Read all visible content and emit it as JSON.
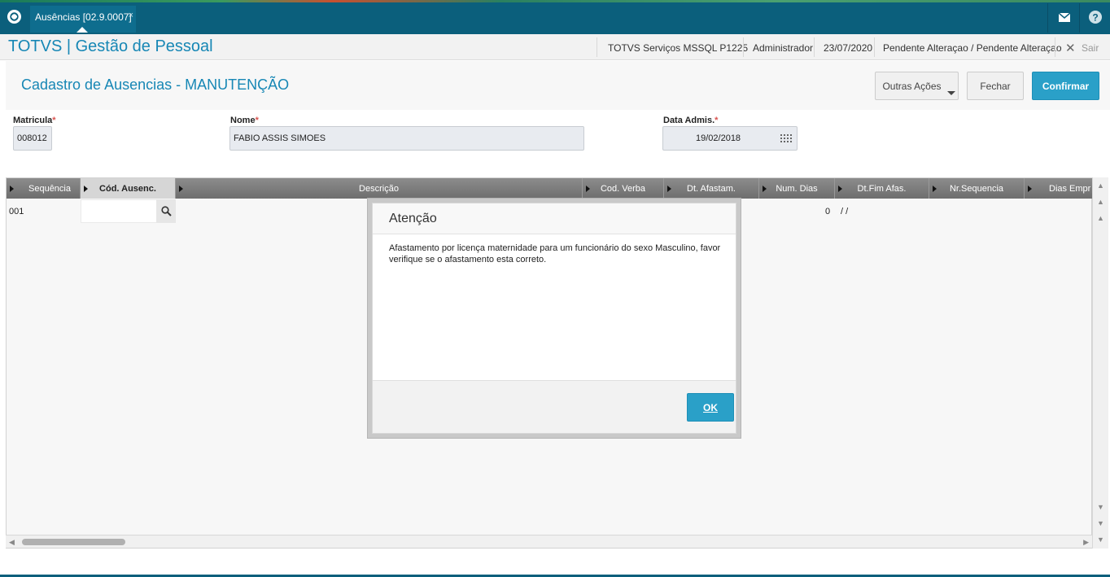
{
  "topbar": {
    "tab_label": "Ausências [02.9.0007]",
    "tab_close": "×",
    "icons": [
      "totvs-logo-icon",
      "mail-icon",
      "help-icon"
    ]
  },
  "header": {
    "app_title": "TOTVS | Gestão de Pessoal",
    "environment": "TOTVS Serviços MSSQL P1225",
    "user": "Administrador",
    "date": "23/07/2020",
    "status": "Pendente Alteraçao / Pendente Alteraçao",
    "exit_label": "Sair"
  },
  "page": {
    "title": "Cadastro de Ausencias - MANUTENÇÃO",
    "actions": {
      "other_actions": "Outras Ações",
      "close": "Fechar",
      "confirm": "Confirmar"
    }
  },
  "form": {
    "matricula": {
      "label": "Matricula",
      "required": "*",
      "value": "008012"
    },
    "nome": {
      "label": "Nome",
      "required": "*",
      "value": "FABIO ASSIS SIMOES"
    },
    "data_admis": {
      "label": "Data Admis.",
      "required": "*",
      "value": "19/02/2018"
    }
  },
  "grid": {
    "columns": [
      "Sequência",
      "Cód. Ausenc.",
      "Descrição",
      "Cod. Verba",
      "Dt. Afastam.",
      "Num. Dias",
      "Dt.Fim Afas.",
      "Nr.Sequencia",
      "Dias Empr"
    ],
    "rows": [
      {
        "sequencia": "001",
        "cod_ausenc": "",
        "num_dias": "0",
        "dt_fim": "/ /"
      }
    ]
  },
  "dialog": {
    "title": "Atenção",
    "message": "Afastamento por licença maternidade para um funcionário do sexo Masculino, favor verifique se o afastamento esta correto.",
    "ok_label": "OK"
  },
  "colors": {
    "topbar": "#0b5f7c",
    "accent": "#1787b5",
    "primary_button": "#2aa0c8",
    "grid_header": "#7a7a7a"
  }
}
